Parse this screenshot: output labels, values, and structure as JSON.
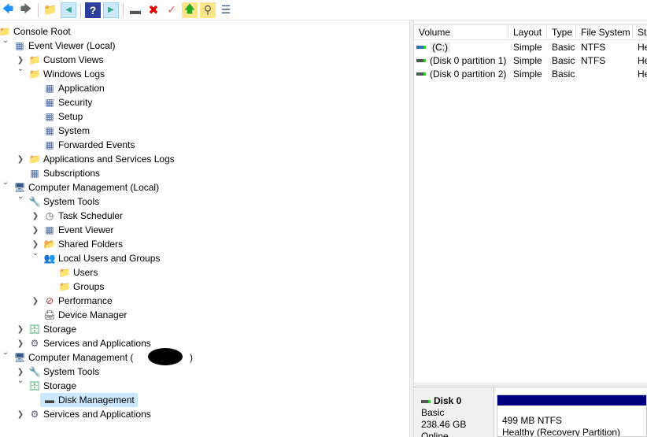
{
  "toolbar": {
    "icons": [
      "back-arrow-icon",
      "forward-arrow-icon",
      "up-folder-icon",
      "show-hide-console-tree-icon",
      "help-icon",
      "show-hide-action-pane-icon",
      "connect-drive-icon",
      "delete-icon",
      "properties-icon",
      "import-icon",
      "search-icon",
      "settings-icon"
    ]
  },
  "tree": [
    {
      "label": "Console Root",
      "level": 0,
      "chev": "",
      "icon": "folder"
    },
    {
      "label": "Event Viewer (Local)",
      "level": 1,
      "chev": "v",
      "icon": "log"
    },
    {
      "label": "Custom Views",
      "level": 2,
      "chev": ">",
      "icon": "folder"
    },
    {
      "label": "Windows Logs",
      "level": 2,
      "chev": "v",
      "icon": "folder"
    },
    {
      "label": "Application",
      "level": 3,
      "chev": "",
      "icon": "log"
    },
    {
      "label": "Security",
      "level": 3,
      "chev": "",
      "icon": "log"
    },
    {
      "label": "Setup",
      "level": 3,
      "chev": "",
      "icon": "log"
    },
    {
      "label": "System",
      "level": 3,
      "chev": "",
      "icon": "log"
    },
    {
      "label": "Forwarded Events",
      "level": 3,
      "chev": "",
      "icon": "log"
    },
    {
      "label": "Applications and Services Logs",
      "level": 2,
      "chev": ">",
      "icon": "folder"
    },
    {
      "label": "Subscriptions",
      "level": 2,
      "chev": "",
      "icon": "log"
    },
    {
      "label": "Computer Management (Local)",
      "level": 1,
      "chev": "v",
      "icon": "computer"
    },
    {
      "label": "System Tools",
      "level": 2,
      "chev": "v",
      "icon": "tools"
    },
    {
      "label": "Task Scheduler",
      "level": 3,
      "chev": ">",
      "icon": "clock"
    },
    {
      "label": "Event Viewer",
      "level": 3,
      "chev": ">",
      "icon": "log"
    },
    {
      "label": "Shared Folders",
      "level": 3,
      "chev": ">",
      "icon": "share"
    },
    {
      "label": "Local Users and Groups",
      "level": 3,
      "chev": "v",
      "icon": "users"
    },
    {
      "label": "Users",
      "level": 4,
      "chev": "",
      "icon": "folder"
    },
    {
      "label": "Groups",
      "level": 4,
      "chev": "",
      "icon": "folder"
    },
    {
      "label": "Performance",
      "level": 3,
      "chev": ">",
      "icon": "perf"
    },
    {
      "label": "Device Manager",
      "level": 3,
      "chev": "",
      "icon": "device"
    },
    {
      "label": "Storage",
      "level": 2,
      "chev": ">",
      "icon": "storage"
    },
    {
      "label": "Services and Applications",
      "level": 2,
      "chev": ">",
      "icon": "services"
    },
    {
      "label": "Computer Management (",
      "level": 1,
      "chev": "v",
      "icon": "computer",
      "suffix": ")"
    },
    {
      "label": "System Tools",
      "level": 2,
      "chev": ">",
      "icon": "tools"
    },
    {
      "label": "Storage",
      "level": 2,
      "chev": "v",
      "icon": "storage"
    },
    {
      "label": "Disk Management",
      "level": 3,
      "chev": "",
      "icon": "disk",
      "selected": true
    },
    {
      "label": "Services and Applications",
      "level": 2,
      "chev": ">",
      "icon": "services"
    }
  ],
  "volumes": {
    "headers": [
      "Volume",
      "Layout",
      "Type",
      "File System",
      "Sta"
    ],
    "rows": [
      [
        "(C:)",
        "Simple",
        "Basic",
        "NTFS",
        "He"
      ],
      [
        "(Disk 0 partition 1)",
        "Simple",
        "Basic",
        "NTFS",
        "He"
      ],
      [
        "(Disk 0 partition 2)",
        "Simple",
        "Basic",
        "",
        "He"
      ]
    ]
  },
  "disk": {
    "name": "Disk 0",
    "type": "Basic",
    "size": "238.46 GB",
    "status": "Online",
    "partition": {
      "size": "499 MB NTFS",
      "status": "Healthy (Recovery Partition)"
    }
  }
}
